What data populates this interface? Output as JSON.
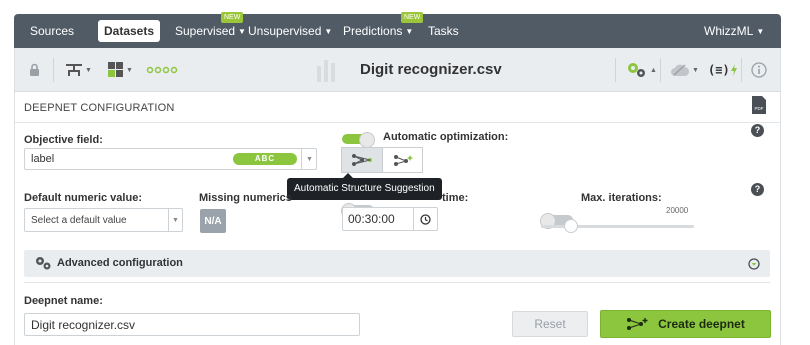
{
  "nav": {
    "items": [
      {
        "label": "Sources"
      },
      {
        "label": "Datasets",
        "active": true
      },
      {
        "label": "Supervised",
        "badge": "NEW"
      },
      {
        "label": "Unsupervised"
      },
      {
        "label": "Predictions",
        "badge": "NEW"
      },
      {
        "label": "Tasks"
      }
    ],
    "user": "WhizzML"
  },
  "toolbar": {
    "title": "Digit recognizer.csv",
    "icons": [
      "lock-icon",
      "tree-icon",
      "field-types-icon",
      "dots-icon",
      "configure-icon",
      "cloud-icon",
      "formula-icon",
      "info-icon"
    ]
  },
  "config": {
    "section_title": "DEEPNET CONFIGURATION",
    "objective": {
      "label": "Objective field:",
      "value": "label",
      "type_badge": "ABC"
    },
    "auto_opt": {
      "label": "Automatic optimization:",
      "enabled": true
    },
    "tooltip": "Automatic Structure Suggestion",
    "default_numeric": {
      "label": "Default numeric value:",
      "placeholder": "Select a default value"
    },
    "missing_numerics": {
      "label": "Missing numerics",
      "button": "N/A"
    },
    "max_training": {
      "label_visible": "time:",
      "value": "00:30:00"
    },
    "max_iterations": {
      "label": "Max. iterations:",
      "value": "20000",
      "enabled": false
    },
    "advanced_label": "Advanced configuration",
    "name": {
      "label": "Deepnet name:",
      "value": "Digit recognizer.csv"
    },
    "reset_label": "Reset",
    "create_label": "Create deepnet"
  },
  "colors": {
    "nav_bg": "#505b66",
    "accent_green": "#8cc63f",
    "toolbar_bg": "#eaedf0"
  }
}
